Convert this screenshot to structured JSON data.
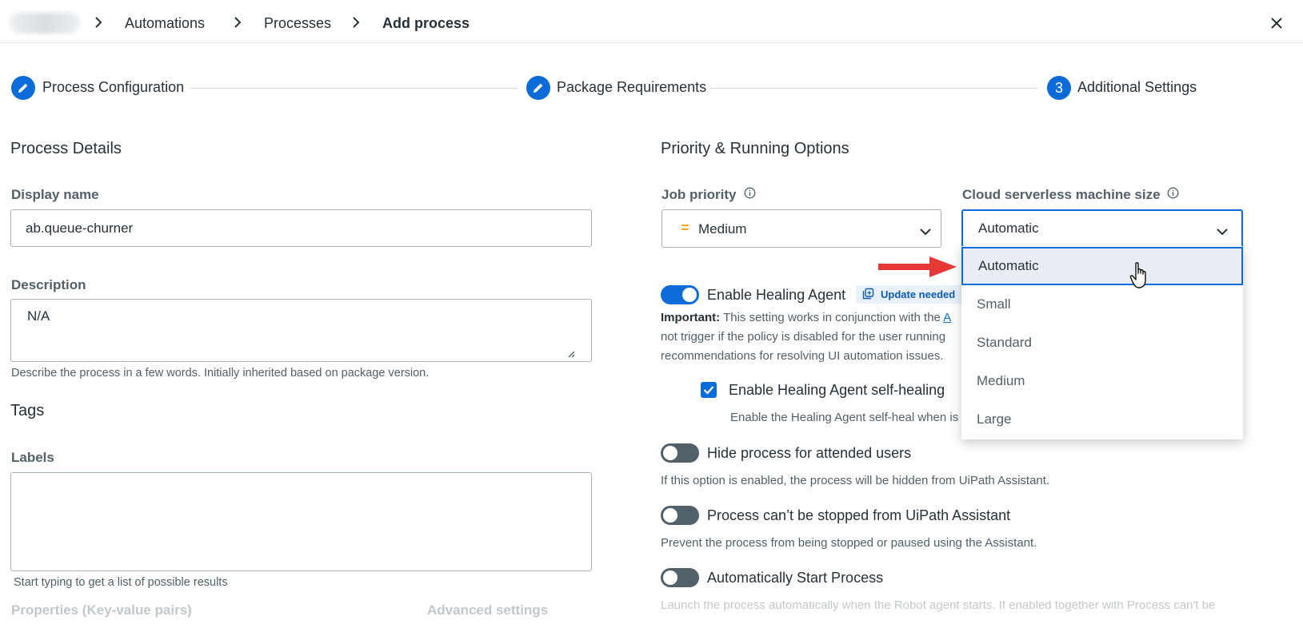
{
  "breadcrumb": {
    "items": [
      "Automations",
      "Processes",
      "Add process"
    ]
  },
  "stepper": {
    "steps": [
      {
        "label": "Process Configuration",
        "marker": "edit"
      },
      {
        "label": "Package Requirements",
        "marker": "edit"
      },
      {
        "label": "Additional Settings",
        "marker": "3"
      }
    ]
  },
  "process_details": {
    "title": "Process Details",
    "display_name_label": "Display name",
    "display_name_value": "ab.queue-churner",
    "description_label": "Description",
    "description_value": "N/A",
    "description_helper": "Describe the process in a few words. Initially inherited based on package version."
  },
  "tags": {
    "title": "Tags",
    "labels_label": "Labels",
    "labels_helper": "Start typing to get a list of possible results",
    "properties_faded": "Properties (Key-value pairs)",
    "advanced_faded": "Advanced settings"
  },
  "priority": {
    "title": "Priority & Running Options",
    "job_priority_label": "Job priority",
    "job_priority_value": "Medium",
    "job_priority_mark": "=",
    "machine_size_label": "Cloud serverless machine size",
    "machine_size_value": "Automatic",
    "machine_size_options": [
      "Automatic",
      "Small",
      "Standard",
      "Medium",
      "Large"
    ]
  },
  "healing_agent": {
    "label": "Enable Healing Agent",
    "badge": "Update needed",
    "important_prefix": "Important:",
    "important_line1": "This setting works in conjunction with the",
    "important_link_fragment": "A",
    "important_line2": "not trigger if the policy is disabled for the user running",
    "important_line3": "recommendations for resolving UI automation issues.",
    "self_healing_label": "Enable Healing Agent self-healing",
    "self_healing_desc": "Enable the Healing Agent self-heal when is"
  },
  "options": {
    "hide_label": "Hide process for attended users",
    "hide_desc": "If this option is enabled, the process will be hidden from UiPath Assistant.",
    "stop_label": "Process can’t be stopped from UiPath Assistant",
    "stop_desc": "Prevent the process from being stopped or paused using the Assistant.",
    "autostart_label": "Automatically Start Process",
    "autostart_desc_faded": "Launch the process automatically when the Robot agent starts. If enabled together with Process can't be"
  },
  "colors": {
    "accent": "#0b6bd9",
    "priority_medium": "#f5a623",
    "annotation_arrow": "#e53935"
  }
}
